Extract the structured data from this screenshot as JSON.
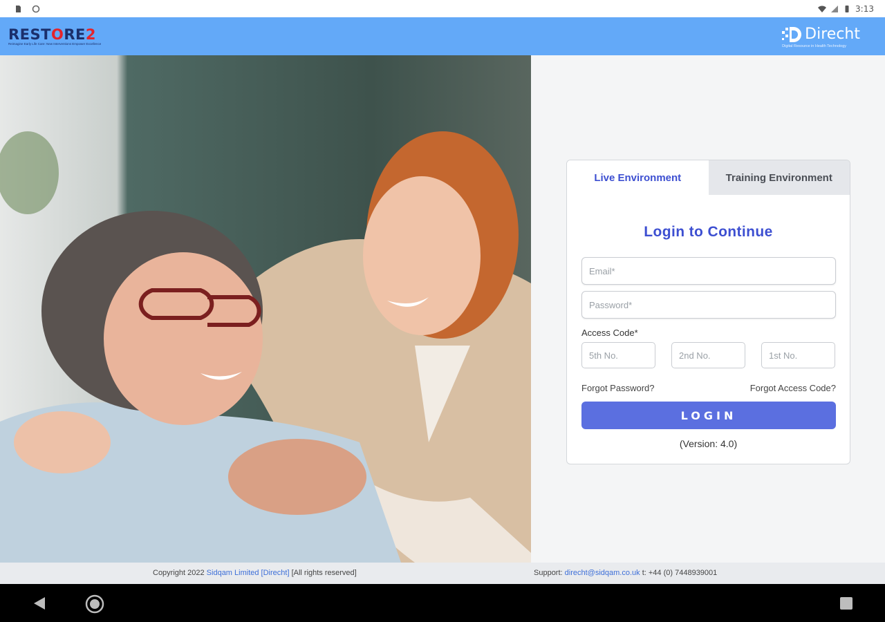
{
  "status_bar": {
    "time": "3:13"
  },
  "header": {
    "left_logo": {
      "text_main": "REST",
      "text_o": "O",
      "text_re": "RE",
      "text_two": "2",
      "tagline": "Reimagine Early Life Care: New Interventions Empower Excellence"
    },
    "right_logo": {
      "name": "Direcht",
      "tagline": "Digital Resource in Health Technology"
    }
  },
  "photo": {
    "alt": "elderly woman and caregiver smiling"
  },
  "login": {
    "tabs": [
      {
        "label": "Live Environment",
        "active": true
      },
      {
        "label": "Training Environment",
        "active": false
      }
    ],
    "title": "Login to Continue",
    "email_placeholder": "Email*",
    "password_placeholder": "Password*",
    "access_code_label": "Access Code*",
    "code_placeholders": [
      "5th No.",
      "2nd No.",
      "1st No."
    ],
    "forgot_password": "Forgot Password?",
    "forgot_access_code": "Forgot Access Code?",
    "login_button": "LOGIN",
    "version": "(Version: 4.0)"
  },
  "footer": {
    "copyright_prefix": "Copyright 2022",
    "company_link": "Sidqam Limited [Direcht]",
    "rights": "[All rights reserved]",
    "support_label": "Support:",
    "support_email": "direcht@sidqam.co.uk",
    "support_phone": "t: +44 (0) 7448939001"
  },
  "colors": {
    "header_bg": "#63a9f8",
    "accent": "#3d4fd1",
    "button": "#5b6fe0",
    "logo_red": "#e4242b",
    "logo_navy": "#1b2f6b"
  }
}
